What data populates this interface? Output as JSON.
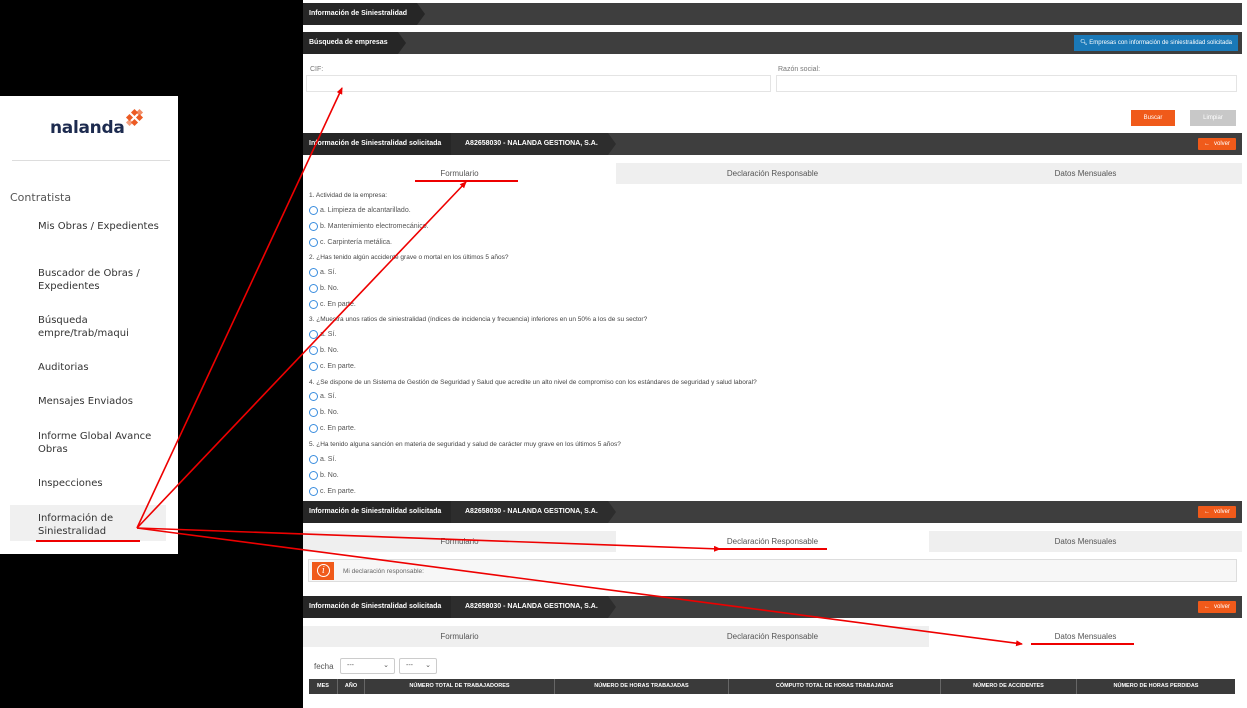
{
  "sidebar": {
    "logo_text": "nalanda",
    "section": "Contratista",
    "items": [
      {
        "label": "Mis Obras / Expedientes"
      },
      {
        "label": "Buscador de Obras / Expedientes"
      },
      {
        "label": "Búsqueda empre/trab/maqui"
      },
      {
        "label": "Auditorias"
      },
      {
        "label": "Mensajes Enviados"
      },
      {
        "label": "Informe Global Avance Obras"
      },
      {
        "label": "Inspecciones"
      },
      {
        "label": "Información de Siniestralidad"
      }
    ],
    "active_item": "Información de Siniestralidad"
  },
  "header": {
    "title": "Información de Siniestralidad"
  },
  "search": {
    "title": "Búsqueda de empresas",
    "top_button": "Empresas con información de siniestralidad solicitada",
    "cif_label": "CIF:",
    "razon_label": "Razón social:",
    "cif_value": "",
    "razon_value": "",
    "buscar": "Buscar",
    "limpiar": "Limpiar"
  },
  "result_bar": {
    "label": "Información de Siniestralidad solicitada",
    "company": "A82658030 - NALANDA GESTIONA, S.A.",
    "volver": "volver"
  },
  "tabs": [
    "Formulario",
    "Declaración Responsable",
    "Datos Mensuales"
  ],
  "form": {
    "questions": [
      {
        "text": "1. Actividad de la empresa:",
        "options": [
          "a. Limpieza de alcantarillado.",
          "b. Mantenimiento electromecánico.",
          "c. Carpintería metálica."
        ]
      },
      {
        "text": "2. ¿Has tenido algún accidente grave o mortal en los últimos 5 años?",
        "options": [
          "a. Sí.",
          "b. No.",
          "c. En parte."
        ]
      },
      {
        "text": "3. ¿Muestra unos ratios de siniestralidad (índices de incidencia y frecuencia) inferiores en un 50% a los de su sector?",
        "options": [
          "a. Sí.",
          "b. No.",
          "c. En parte."
        ]
      },
      {
        "text": "4. ¿Se dispone de un Sistema de Gestión de Seguridad y Salud que acredite un alto nivel de compromiso con los estándares de seguridad y salud laboral?",
        "options": [
          "a. Sí.",
          "b. No.",
          "c. En parte."
        ]
      },
      {
        "text": "5. ¿Ha tenido alguna sanción en materia de seguridad y salud de carácter muy grave en los últimos 5 años?",
        "options": [
          "a. Sí.",
          "b. No.",
          "c. En parte."
        ]
      }
    ]
  },
  "declaration": {
    "text": "Mi declaración responsable:"
  },
  "monthly": {
    "fecha_label": "fecha",
    "select_month": "---",
    "select_year": "---",
    "columns": [
      "MES",
      "AÑO",
      "NÚMERO TOTAL DE TRABAJADORES",
      "NÚMERO DE HORAS TRABAJADAS",
      "CÓMPUTO TOTAL DE HORAS TRABAJADAS",
      "NÚMERO DE ACCIDENTES",
      "NÚMERO DE HORAS PERDIDAS"
    ]
  },
  "colors": {
    "accent": "#f05a1a",
    "bar_dark": "#3e3e3e",
    "link_blue": "#1a79b8",
    "annotation": "#e00000"
  }
}
